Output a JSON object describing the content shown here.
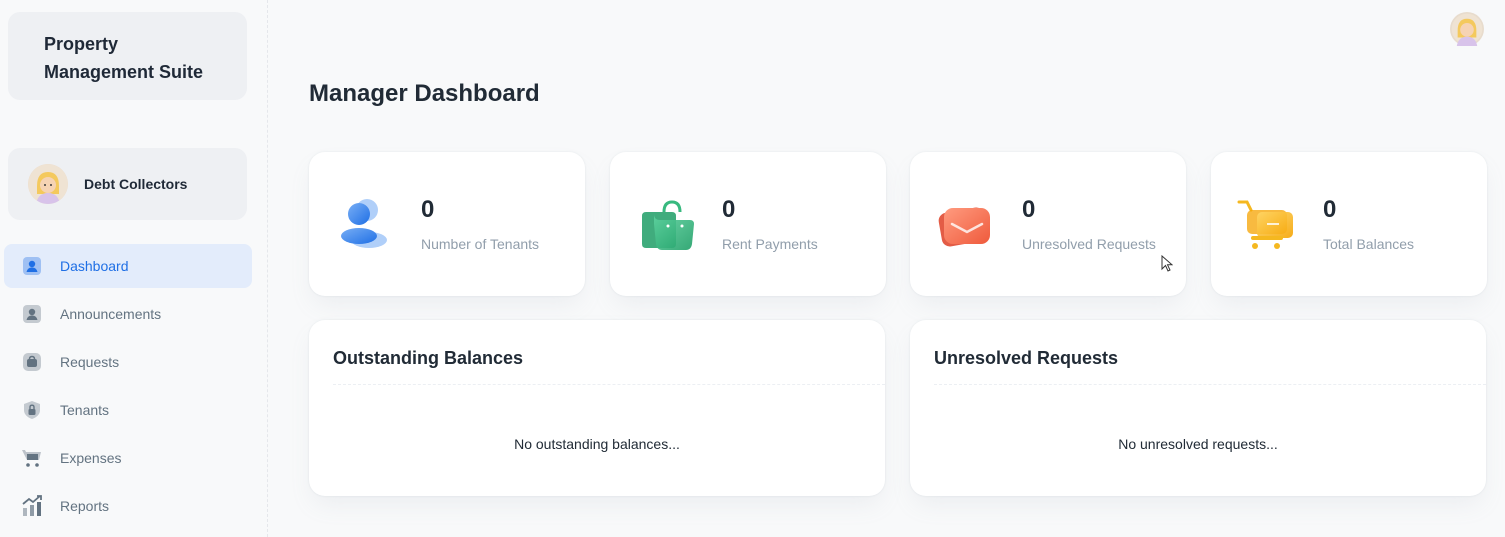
{
  "app": {
    "brand_line1": "Property",
    "brand_line2": "Management Suite"
  },
  "account": {
    "name": "Debt Collectors"
  },
  "sidebar": {
    "items": [
      {
        "label": "Dashboard",
        "icon": "user-icon",
        "active": true
      },
      {
        "label": "Announcements",
        "icon": "user-icon",
        "active": false
      },
      {
        "label": "Requests",
        "icon": "bag-icon",
        "active": false
      },
      {
        "label": "Tenants",
        "icon": "lock-icon",
        "active": false
      },
      {
        "label": "Expenses",
        "icon": "cart-icon",
        "active": false
      },
      {
        "label": "Reports",
        "icon": "chart-icon",
        "active": false
      }
    ]
  },
  "main": {
    "title": "Manager Dashboard",
    "stats": [
      {
        "value": "0",
        "label": "Number of Tenants",
        "icon": "users-icon",
        "color": "#1f6fe5"
      },
      {
        "value": "0",
        "label": "Rent Payments",
        "icon": "shopping-bag-icon",
        "color": "#22a06b"
      },
      {
        "value": "0",
        "label": "Unresolved Requests",
        "icon": "mail-icon",
        "color": "#ef5a3c"
      },
      {
        "value": "0",
        "label": "Total Balances",
        "icon": "shopping-cart-icon",
        "color": "#f5b820"
      }
    ],
    "panels": [
      {
        "title": "Outstanding Balances",
        "empty_text": "No outstanding balances..."
      },
      {
        "title": "Unresolved Requests",
        "empty_text": "No unresolved requests..."
      }
    ]
  },
  "colors": {
    "accent": "#1f6fe5",
    "active_bg": "#e3ecfb",
    "muted_text": "#637381",
    "label_text": "#919eab"
  }
}
